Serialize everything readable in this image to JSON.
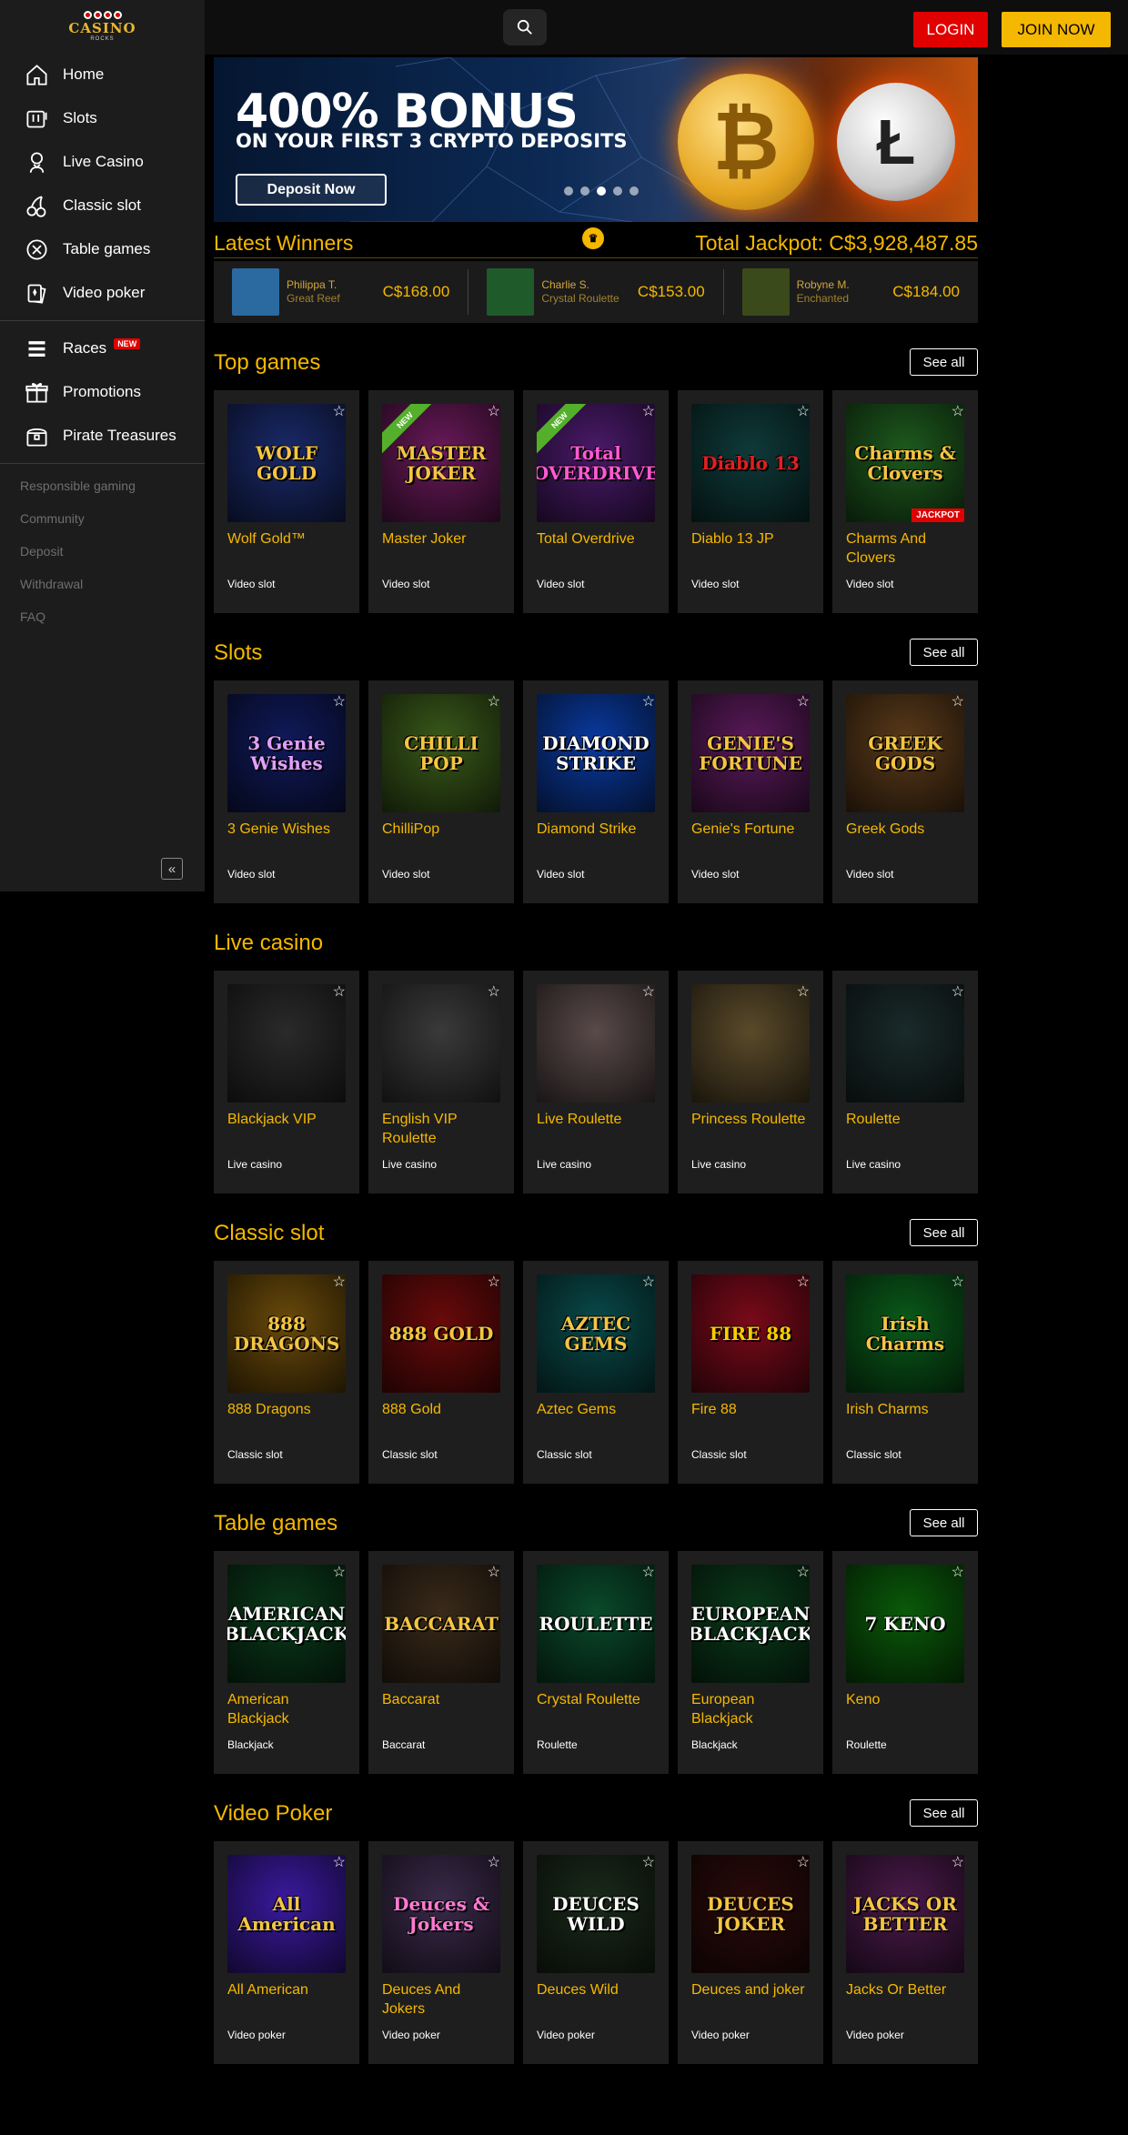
{
  "header": {
    "logo_text": "CASINO",
    "logo_sub": "ROCKS",
    "login": "LOGIN",
    "join": "JOIN NOW"
  },
  "sidebar": {
    "main": [
      {
        "label": "Home",
        "icon": "home-icon"
      },
      {
        "label": "Slots",
        "icon": "slot-machine-icon"
      },
      {
        "label": "Live Casino",
        "icon": "dealer-icon"
      },
      {
        "label": "Classic slot",
        "icon": "cherries-icon"
      },
      {
        "label": "Table games",
        "icon": "roulette-chip-icon"
      },
      {
        "label": "Video poker",
        "icon": "cards-icon"
      }
    ],
    "extra": [
      {
        "label": "Races",
        "icon": "races-icon",
        "badge": "NEW"
      },
      {
        "label": "Promotions",
        "icon": "gift-icon"
      },
      {
        "label": "Pirate Treasures",
        "icon": "treasure-chest-icon"
      }
    ],
    "links": [
      "Responsible gaming",
      "Community",
      "Deposit",
      "Withdrawal",
      "FAQ"
    ],
    "collapse": "«"
  },
  "banner": {
    "title": "400% BONUS",
    "subtitle": "ON YOUR FIRST 3 CRYPTO DEPOSITS",
    "button": "Deposit Now",
    "coin1": "₿",
    "coin2": "Ł",
    "slides": 5,
    "active_slide": 3
  },
  "winners": {
    "title": "Latest Winners",
    "jackpot_label": "Total Jackpot:",
    "jackpot_value": "C$3,928,487.85",
    "items": [
      {
        "name": "Philippa T.",
        "game": "Great Reef",
        "amount": "C$168.00",
        "color": "#2a6aa0"
      },
      {
        "name": "Charlie S.",
        "game": "Crystal Roulette",
        "amount": "C$153.00",
        "color": "#1f5a2a"
      },
      {
        "name": "Robyne M.",
        "game": "Enchanted",
        "amount": "C$184.00",
        "color": "#3a4a1a"
      }
    ]
  },
  "see_all": "See all",
  "sections": [
    {
      "title": "Top games",
      "see_all": true,
      "games": [
        {
          "name": "Wolf Gold™",
          "cat": "Video slot",
          "art": "WOLF GOLD",
          "bg": "#1a2a6a",
          "fg": "#f5c542"
        },
        {
          "name": "Master Joker",
          "cat": "Video slot",
          "art": "MASTER JOKER",
          "bg": "#6a1a5a",
          "fg": "#f5c542",
          "ribbon": "NEW"
        },
        {
          "name": "Total Overdrive",
          "cat": "Video slot",
          "art": "Total OVERDRIVE",
          "bg": "#4a1a6a",
          "fg": "#ff5ad2",
          "ribbon": "NEW"
        },
        {
          "name": "Diablo 13 JP",
          "cat": "Video slot",
          "art": "Diablo 13",
          "bg": "#0f3a3a",
          "fg": "#e02020"
        },
        {
          "name": "Charms And Clovers",
          "cat": "Video slot",
          "art": "Charms & Clovers",
          "bg": "#1e5a1e",
          "fg": "#f5c542",
          "jackpot": "JACKPOT"
        }
      ]
    },
    {
      "title": "Slots",
      "see_all": true,
      "games": [
        {
          "name": "3 Genie Wishes",
          "cat": "Video slot",
          "art": "3 Genie Wishes",
          "bg": "#101a5a",
          "fg": "#e0a0ff"
        },
        {
          "name": "ChilliPop",
          "cat": "Video slot",
          "art": "CHILLI POP",
          "bg": "#3a5a1a",
          "fg": "#f5c542"
        },
        {
          "name": "Diamond Strike",
          "cat": "Video slot",
          "art": "DIAMOND STRIKE",
          "bg": "#0a3aa0",
          "fg": "#ffffff"
        },
        {
          "name": "Genie's Fortune",
          "cat": "Video slot",
          "art": "GENIE'S FORTUNE",
          "bg": "#5a1a5a",
          "fg": "#f5c542"
        },
        {
          "name": "Greek Gods",
          "cat": "Video slot",
          "art": "GREEK GODS",
          "bg": "#5a3a1a",
          "fg": "#f5c542"
        }
      ]
    },
    {
      "title": "Live casino",
      "see_all": false,
      "games": [
        {
          "name": "Blackjack VIP",
          "cat": "Live casino",
          "art": "",
          "bg": "#2a2a2a",
          "fg": "#fff"
        },
        {
          "name": "English VIP Roulette",
          "cat": "Live casino",
          "art": "",
          "bg": "#3a3a3a",
          "fg": "#fff"
        },
        {
          "name": "Live Roulette",
          "cat": "Live casino",
          "art": "",
          "bg": "#5a4a4a",
          "fg": "#fff"
        },
        {
          "name": "Princess Roulette",
          "cat": "Live casino",
          "art": "",
          "bg": "#5a4a2a",
          "fg": "#fff"
        },
        {
          "name": "Roulette",
          "cat": "Live casino",
          "art": "",
          "bg": "#1a2a2a",
          "fg": "#fff"
        }
      ]
    },
    {
      "title": "Classic slot",
      "see_all": true,
      "games": [
        {
          "name": "888 Dragons",
          "cat": "Classic slot",
          "art": "888 DRAGONS",
          "bg": "#6a4a0a",
          "fg": "#f5c542"
        },
        {
          "name": "888 Gold",
          "cat": "Classic slot",
          "art": "888 GOLD",
          "bg": "#6a0a0a",
          "fg": "#f5c542"
        },
        {
          "name": "Aztec Gems",
          "cat": "Classic slot",
          "art": "AZTEC GEMS",
          "bg": "#0a4a4a",
          "fg": "#f5c542"
        },
        {
          "name": "Fire 88",
          "cat": "Classic slot",
          "art": "FIRE 88",
          "bg": "#7a0a1a",
          "fg": "#ffcc00"
        },
        {
          "name": "Irish Charms",
          "cat": "Classic slot",
          "art": "Irish Charms",
          "bg": "#0a5a1a",
          "fg": "#f5c542"
        }
      ]
    },
    {
      "title": "Table games",
      "see_all": true,
      "games": [
        {
          "name": "American Blackjack",
          "cat": "Blackjack",
          "art": "AMERICAN BLACKJACK",
          "bg": "#0a3a1a",
          "fg": "#ffffff"
        },
        {
          "name": "Baccarat",
          "cat": "Baccarat",
          "art": "BACCARAT",
          "bg": "#3a2a1a",
          "fg": "#f5c542"
        },
        {
          "name": "Crystal Roulette",
          "cat": "Roulette",
          "art": "ROULETTE",
          "bg": "#0a4a2a",
          "fg": "#ffffff"
        },
        {
          "name": "European Blackjack",
          "cat": "Blackjack",
          "art": "EUROPEAN BLACKJACK",
          "bg": "#0a3a1a",
          "fg": "#ffffff"
        },
        {
          "name": "Keno",
          "cat": "Roulette",
          "art": "7 KENO",
          "bg": "#0a5a0a",
          "fg": "#ffffff"
        }
      ]
    },
    {
      "title": "Video Poker",
      "see_all": true,
      "games": [
        {
          "name": "All American",
          "cat": "Video poker",
          "art": "All American",
          "bg": "#3a1aa0",
          "fg": "#f5c542"
        },
        {
          "name": "Deuces And Jokers",
          "cat": "Video poker",
          "art": "Deuces & Jokers",
          "bg": "#3a2a4a",
          "fg": "#ff7ad2"
        },
        {
          "name": "Deuces Wild",
          "cat": "Video poker",
          "art": "DEUCES WILD",
          "bg": "#1a2a1a",
          "fg": "#ffffff"
        },
        {
          "name": "Deuces and joker",
          "cat": "Video poker",
          "art": "DEUCES JOKER",
          "bg": "#2a0a0a",
          "fg": "#f5c542"
        },
        {
          "name": "Jacks Or Better",
          "cat": "Video poker",
          "art": "JACKS OR BETTER",
          "bg": "#4a1a4a",
          "fg": "#f5c542"
        }
      ]
    }
  ]
}
